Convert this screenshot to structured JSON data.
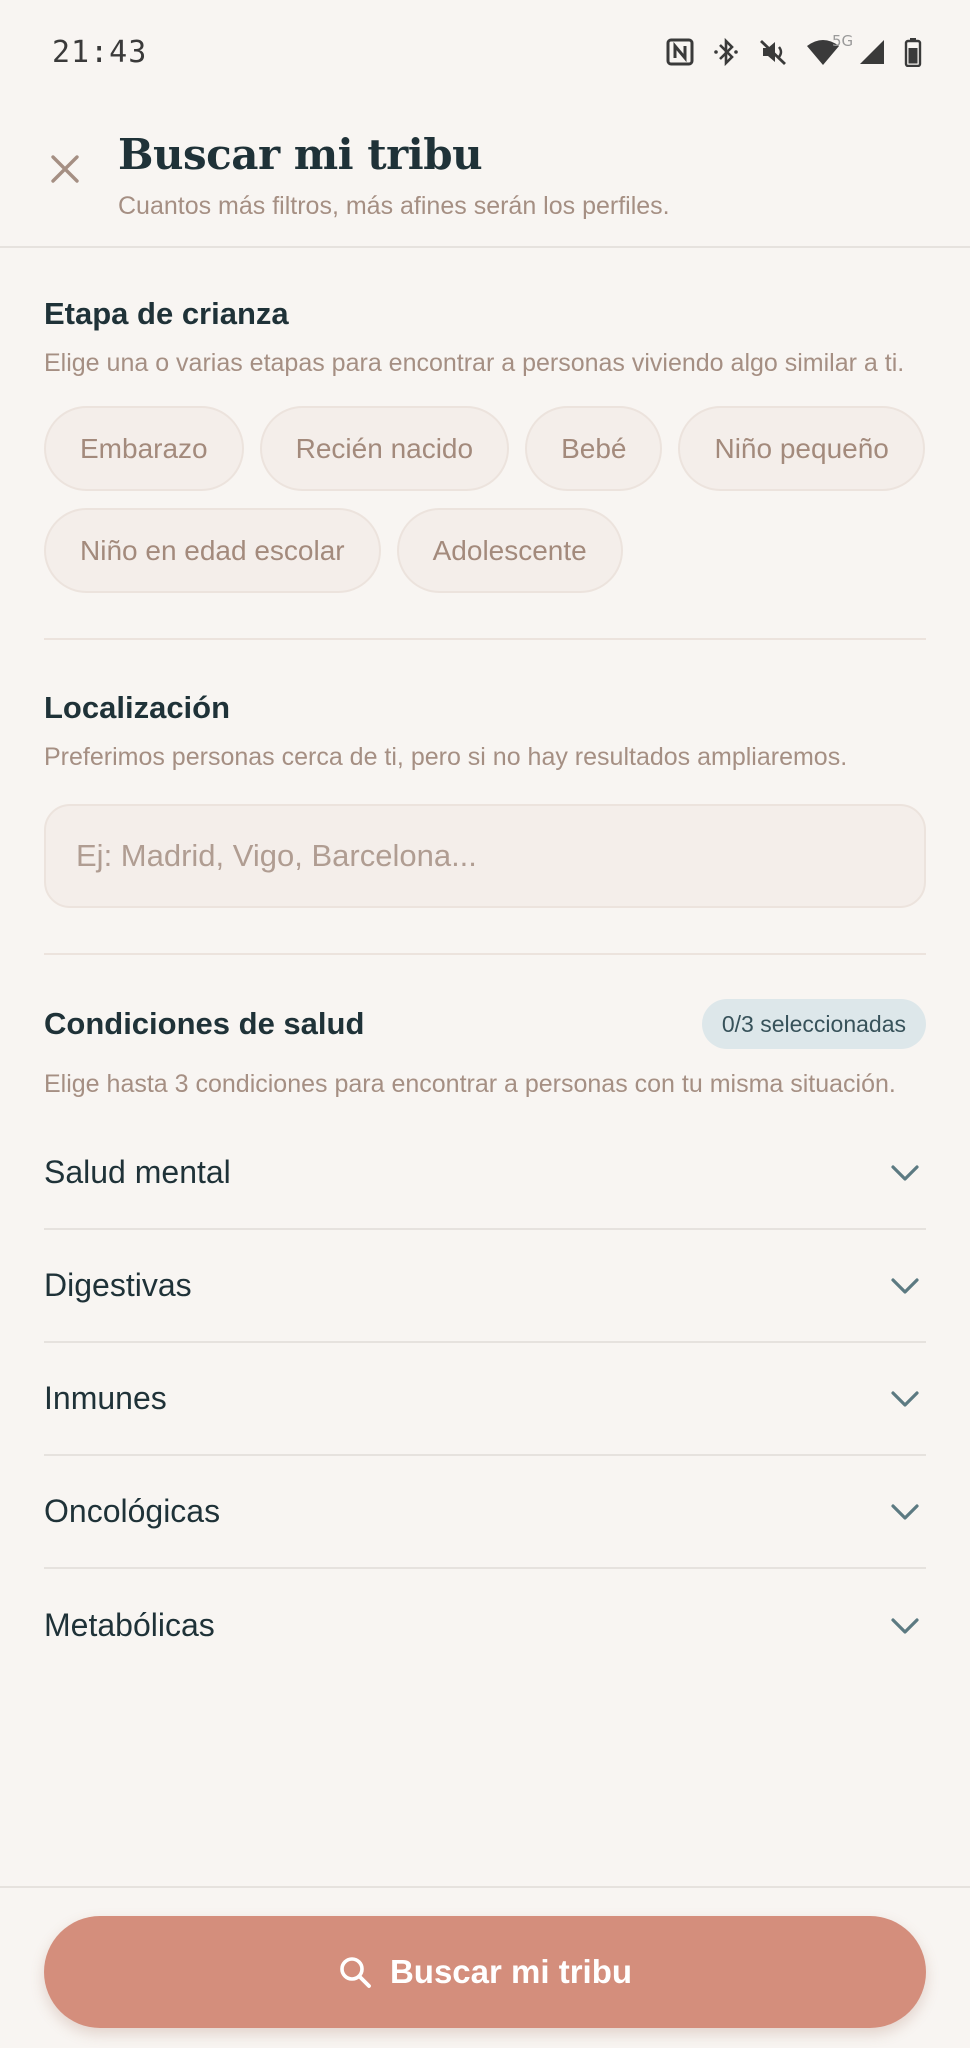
{
  "status_bar": {
    "time": "21:43",
    "network_label": "5G",
    "icons": [
      "nfc-icon",
      "bluetooth-icon",
      "mute-icon",
      "wifi-icon",
      "signal-icon",
      "battery-icon"
    ]
  },
  "header": {
    "title": "Buscar mi tribu",
    "subtitle": "Cuantos más filtros, más afines serán los perfiles."
  },
  "parenting": {
    "title": "Etapa de crianza",
    "description": "Elige una o varias etapas para encontrar a personas viviendo algo similar a ti.",
    "options": [
      {
        "label": "Embarazo"
      },
      {
        "label": "Recién nacido"
      },
      {
        "label": "Bebé"
      },
      {
        "label": "Niño pequeño"
      },
      {
        "label": "Niño en edad escolar"
      },
      {
        "label": "Adolescente"
      }
    ]
  },
  "location": {
    "title": "Localización",
    "description": "Preferimos personas cerca de ti, pero si no hay resultados ampliaremos.",
    "placeholder": "Ej: Madrid, Vigo, Barcelona...",
    "value": ""
  },
  "health": {
    "title": "Condiciones de salud",
    "badge": "0/3 seleccionadas",
    "description": "Elige hasta 3 condiciones para encontrar a personas con tu misma situación.",
    "categories": [
      {
        "label": "Salud mental"
      },
      {
        "label": "Digestivas"
      },
      {
        "label": "Inmunes"
      },
      {
        "label": "Oncológicas"
      },
      {
        "label": "Metabólicas"
      }
    ]
  },
  "footer": {
    "search_label": "Buscar mi tribu"
  },
  "colors": {
    "background": "#f8f5f2",
    "primary_button": "#d48e7c",
    "title_text": "#1f3238",
    "muted_text": "#a58f83",
    "chip_background": "#f4eeea",
    "badge_background": "#dde7ea"
  }
}
